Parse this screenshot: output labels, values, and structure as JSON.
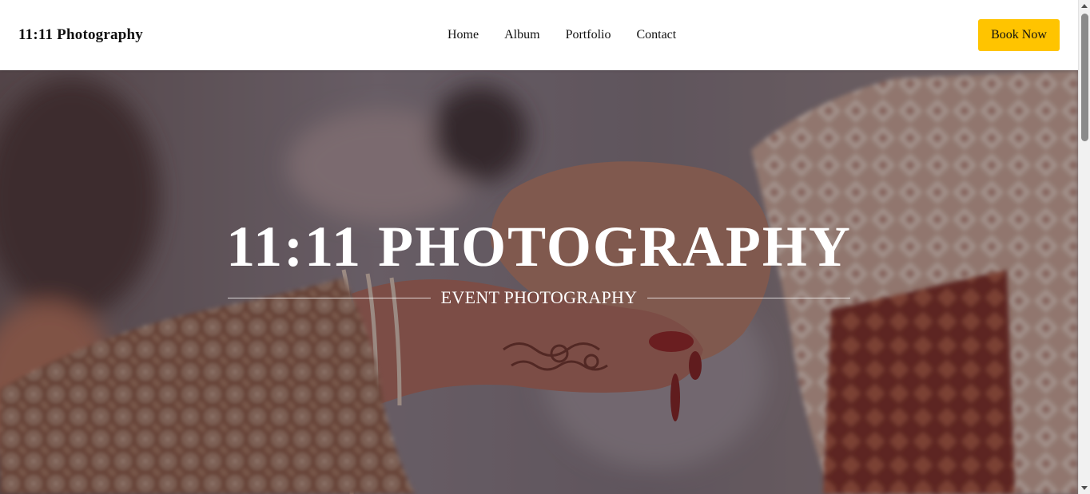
{
  "header": {
    "brand": "11:11 Photography",
    "nav": [
      "Home",
      "Album",
      "Portfolio",
      "Contact"
    ],
    "book_label": "Book Now"
  },
  "hero": {
    "title": "11:11 PHOTOGRAPHY",
    "subtitle": "EVENT PHOTOGRAPHY"
  },
  "colors": {
    "accent": "#FFC400",
    "header_bg": "#FFFFFF",
    "text": "#111111"
  }
}
